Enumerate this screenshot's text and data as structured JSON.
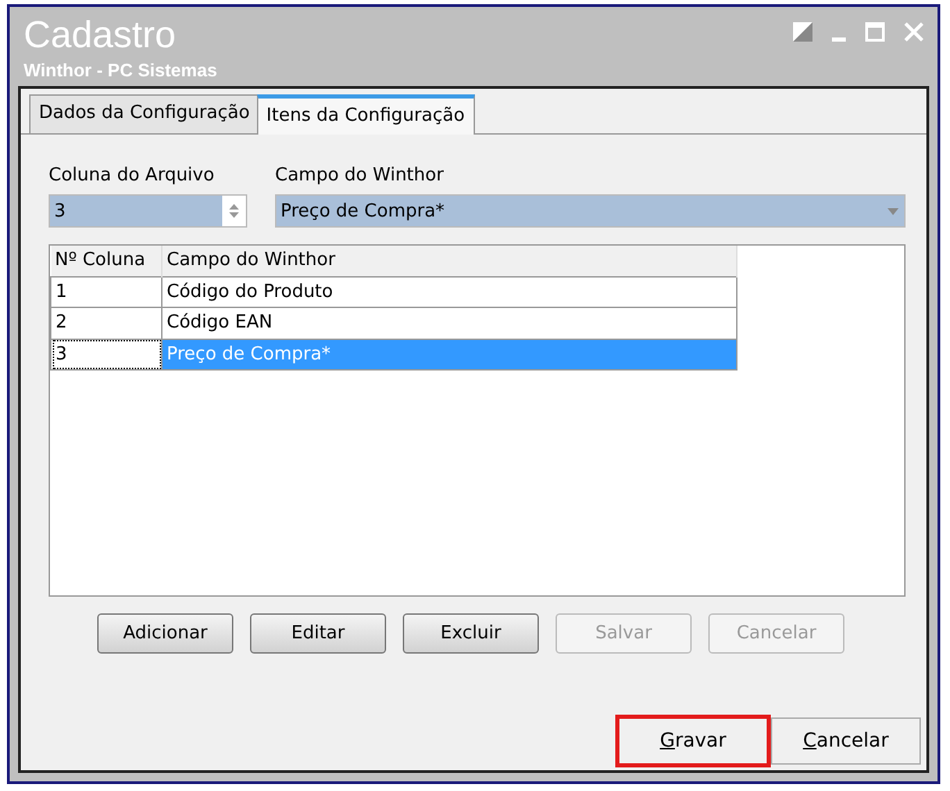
{
  "window": {
    "title": "Cadastro",
    "subtitle": "Winthor - PC Sistemas"
  },
  "tabs": [
    {
      "label": "Dados da Configuração",
      "selected": false
    },
    {
      "label": "Itens da Configuração",
      "selected": true
    }
  ],
  "fields": {
    "coluna": {
      "label": "Coluna do Arquivo",
      "value": "3"
    },
    "campo": {
      "label": "Campo do Winthor",
      "value": "Preço de Compra*"
    }
  },
  "table": {
    "columns": [
      "Nº Coluna",
      "Campo do Winthor"
    ],
    "rows": [
      {
        "cells": [
          "1",
          "Código do Produto"
        ],
        "selected": false
      },
      {
        "cells": [
          "2",
          "Código EAN"
        ],
        "selected": false
      },
      {
        "cells": [
          "3",
          "Preço de Compra*"
        ],
        "selected": true
      }
    ]
  },
  "buttons": [
    {
      "label": "Adicionar",
      "disabled": false
    },
    {
      "label": "Editar",
      "disabled": false
    },
    {
      "label": "Excluir",
      "disabled": false
    },
    {
      "label": "Salvar",
      "disabled": true
    },
    {
      "label": "Cancelar",
      "disabled": true
    }
  ],
  "footer_buttons": [
    {
      "accel": "G",
      "rest": "ravar",
      "highlighted": true
    },
    {
      "accel": "C",
      "rest": "ancelar",
      "highlighted": false
    }
  ]
}
